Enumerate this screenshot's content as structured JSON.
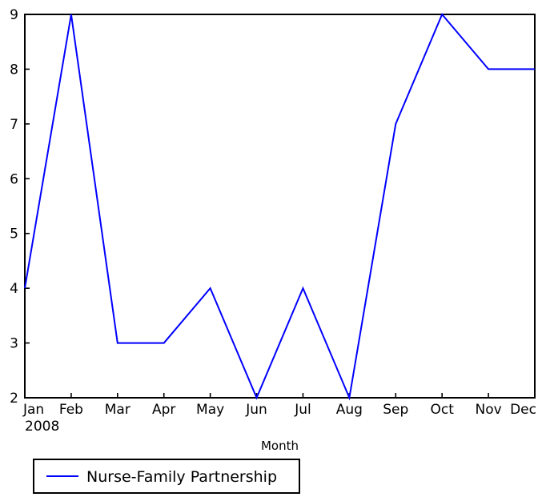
{
  "chart_data": {
    "type": "line",
    "title": "",
    "xlabel": "Month",
    "ylabel": "",
    "x_unit_label": "2008",
    "categories": [
      "Jan",
      "Feb",
      "Mar",
      "Apr",
      "May",
      "Jun",
      "Jul",
      "Aug",
      "Sep",
      "Oct",
      "Nov",
      "Dec"
    ],
    "series": [
      {
        "name": "Nurse-Family Partnership",
        "color": "#0000ff",
        "values": [
          4,
          9,
          3,
          3,
          4,
          2,
          4,
          2,
          7,
          9,
          8,
          8
        ]
      }
    ],
    "ylim": [
      2,
      9
    ],
    "yticks": [
      2,
      3,
      4,
      5,
      6,
      7,
      8,
      9
    ],
    "ytick_labels": [
      "2",
      "3",
      "4",
      "5",
      "6",
      "7",
      "8",
      "9"
    ],
    "xtick_labels": [
      "Jan",
      "Feb",
      "Mar",
      "Apr",
      "May",
      "Jun",
      "Jul",
      "Aug",
      "Sep",
      "Oct",
      "Nov",
      "Dec"
    ],
    "grid": false,
    "legend_position": "below-axes-left",
    "legend_entries": [
      "Nurse-Family Partnership"
    ],
    "background_color": "#ffffff",
    "axis_color": "#000000"
  },
  "axes": {
    "x_axis_title": "Month",
    "x_origin_annotation": "2008"
  },
  "legend": {
    "entry_label": "Nurse-Family Partnership"
  }
}
